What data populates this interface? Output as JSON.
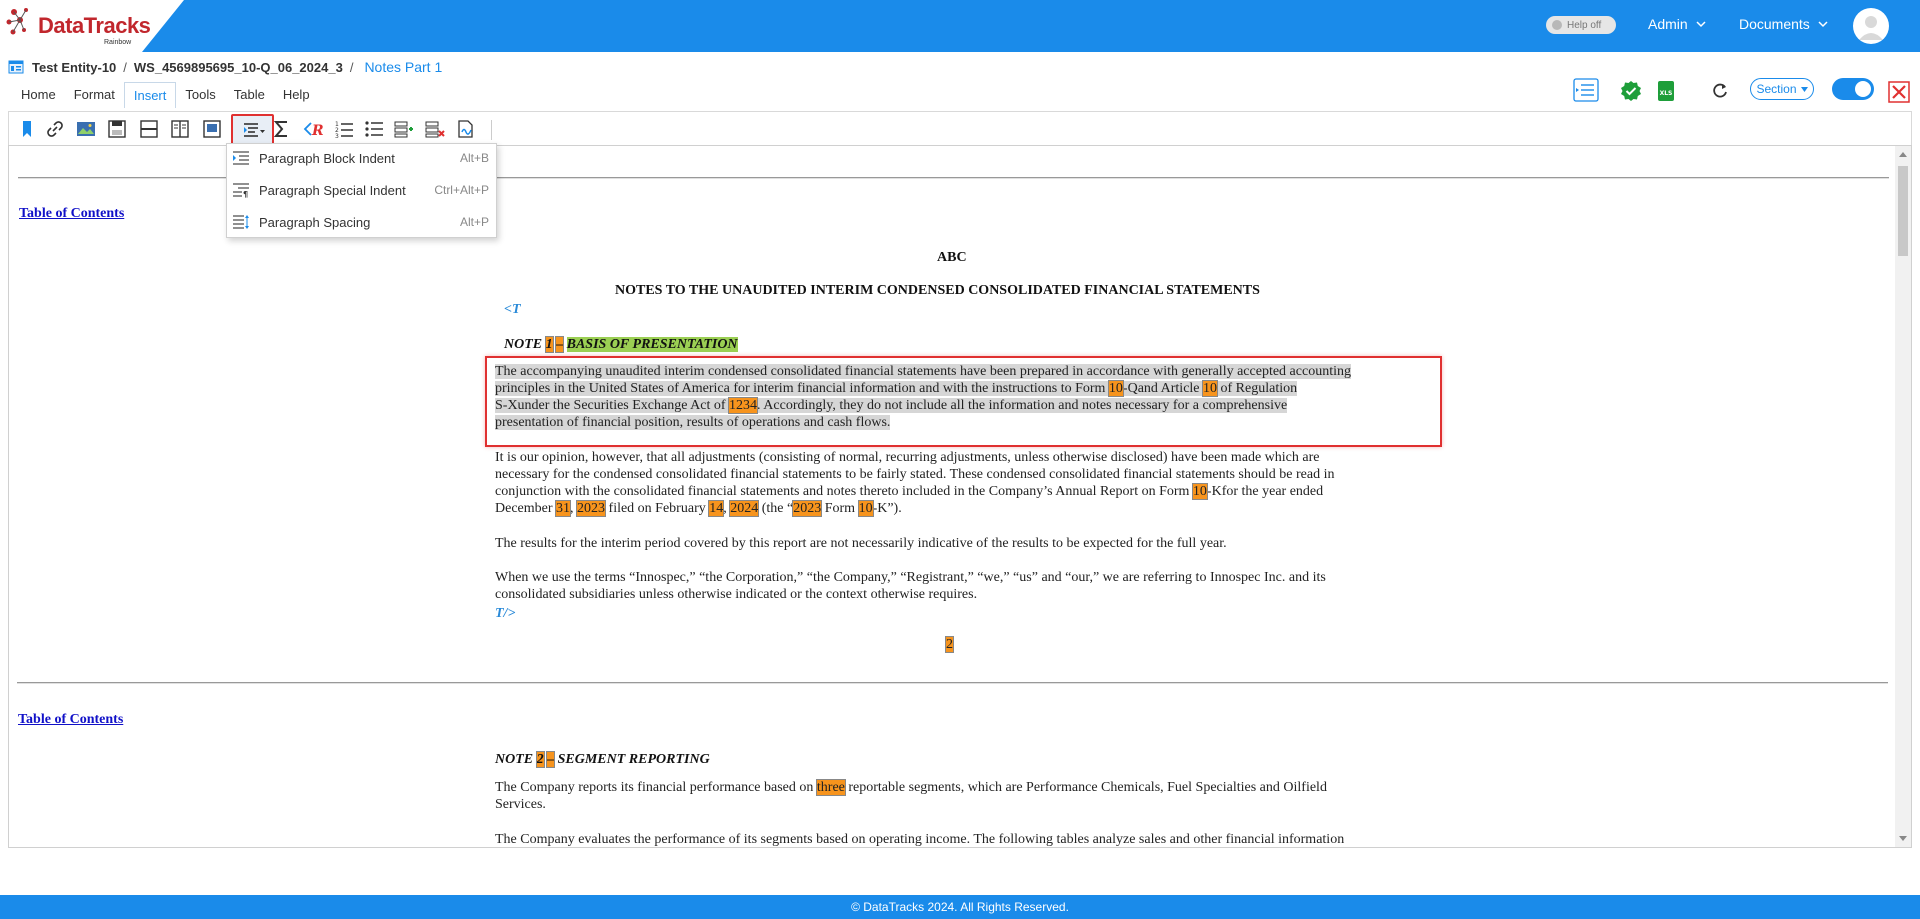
{
  "brand": {
    "name": "DataTracks",
    "sub": "Rainbow",
    "accent": "#1a8bea",
    "logo_red": "#c1272d"
  },
  "topbar": {
    "help_toggle": "Help off",
    "admin": "Admin",
    "documents": "Documents"
  },
  "breadcrumb": {
    "entity": "Test Entity-10",
    "separator": "/",
    "workspace": "WS_4569895695_10-Q_06_2024_3",
    "current": "Notes Part 1"
  },
  "tabs": [
    "Home",
    "Format",
    "Insert",
    "Tools",
    "Table",
    "Help"
  ],
  "active_tab": "Insert",
  "right_tools": {
    "section_select": "Section",
    "toggle_on": true
  },
  "toolbar_icons": [
    "bookmark-icon",
    "link-icon",
    "image-icon",
    "save-icon",
    "horizontal-line-icon",
    "columns-icon",
    "page-icon",
    "paragraph-indent-icon",
    "sigma-icon",
    "rule-icon",
    "numbered-list-icon",
    "bullet-list-icon",
    "add-row-icon",
    "delete-row-icon",
    "signature-icon"
  ],
  "dropdown": {
    "items": [
      {
        "label": "Paragraph Block Indent",
        "shortcut": "Alt+B",
        "icon": "block-indent-icon"
      },
      {
        "label": "Paragraph Special Indent",
        "shortcut": "Ctrl+Alt+P",
        "icon": "special-indent-icon"
      },
      {
        "label": "Paragraph Spacing",
        "shortcut": "Alt+P",
        "icon": "spacing-icon"
      }
    ]
  },
  "document": {
    "toc_link": "Table of Contents",
    "company": "ABC",
    "heading": "NOTES TO THE UNAUDITED INTERIM CONDENSED CONSOLIDATED FINANCIAL STATEMENTS",
    "tag_open": "<T",
    "tag_close": "T/>",
    "note1": {
      "prefix": "NOTE ",
      "num": "1",
      "dash": "–",
      "title": "BASIS OF PRESENTATION"
    },
    "para1": {
      "line1": "The accompanying unaudited interim condensed consolidated financial statements have been prepared in accordance with generally accepted accounting",
      "line2a": "principles in the United States of America for interim financial information and with the instructions to Form ",
      "line2_num1": "10",
      "line2b": "-Qand Article ",
      "line2_num2": "10",
      "line2c": " of Regulation",
      "line3a": "S-Xunder the Securities Exchange Act of ",
      "line3_num": "1234",
      "line3b": ". Accordingly, they do not include all the information and notes necessary for a comprehensive",
      "line4": "presentation of financial position, results of operations and cash flows."
    },
    "para2": {
      "line1": "It is our opinion, however, that all adjustments (consisting of normal, recurring adjustments, unless otherwise disclosed) have been made which are",
      "line2": "necessary for the condensed consolidated financial statements to be fairly stated. These condensed consolidated financial statements should be read in",
      "line3a": "conjunction with the consolidated financial statements and notes thereto included in the Company’s Annual Report on Form ",
      "line3_num": "10",
      "line3b": "-Kfor the year ended",
      "line4a": "December ",
      "line4_n1": "31",
      "line4b": ", ",
      "line4_n2": "2023",
      "line4c": " filed on February ",
      "line4_n3": "14",
      "line4d": ", ",
      "line4_n4": "2024",
      "line4e": " (the “",
      "line4_n5": "2023",
      "line4f": " Form ",
      "line4_n6": "10",
      "line4g": "-K”)."
    },
    "para3": "The results for the interim period covered by this report are not necessarily indicative of the results to be expected for the full year.",
    "para4": {
      "line1": "When we use the terms “Innospec,” “the Corporation,” “the Company,” “Registrant,” “we,” “us” and “our,” we are referring to Innospec Inc. and its",
      "line2": "consolidated subsidiaries unless otherwise indicated or the context otherwise requires."
    },
    "page_number": "2",
    "note2": {
      "prefix": "NOTE ",
      "num": "2",
      "dash": "–",
      "title": "SEGMENT REPORTING"
    },
    "para5": {
      "line1a": "The Company reports its financial performance based on ",
      "line1_hl": "three",
      "line1b": " reportable segments, which are Performance Chemicals, Fuel Specialties and Oilfield",
      "line2": "Services."
    },
    "para6": "The Company evaluates the performance of its segments based on operating income. The following tables analyze sales and other financial information"
  },
  "footer": "© DataTracks 2024. All Rights Reserved."
}
